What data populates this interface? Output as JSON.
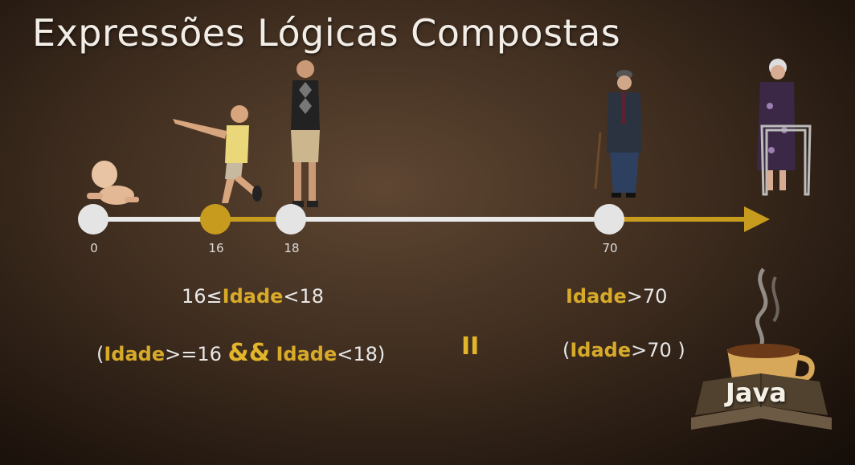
{
  "title": "Expressões Lógicas Compostas",
  "timeline": {
    "ticks": [
      "0",
      "16",
      "18",
      "70"
    ],
    "colors": {
      "line": "#e9e9e9",
      "highlight": "#c79b1d",
      "node": "#e4e4e4"
    }
  },
  "expr1": {
    "prefix": "16≤",
    "var": "Idade",
    "suffix": "<18"
  },
  "expr2": {
    "open": "(",
    "var1": "Idade",
    "cond1": ">=16 ",
    "and": "&&",
    "var2": "Idade",
    "cond2": "<18)"
  },
  "or_operator": "II",
  "expr3": {
    "var": "Idade",
    "suffix": ">70"
  },
  "expr4": {
    "open": "(",
    "var": "Idade",
    "suffix": ">70 )"
  },
  "logo": {
    "label": "Java"
  },
  "icons": [
    "baby-figure-icon",
    "child-figure-icon",
    "teen-figure-icon",
    "elder-man-figure-icon",
    "elder-woman-walker-icon",
    "coffee-cup-icon",
    "book-icon"
  ]
}
